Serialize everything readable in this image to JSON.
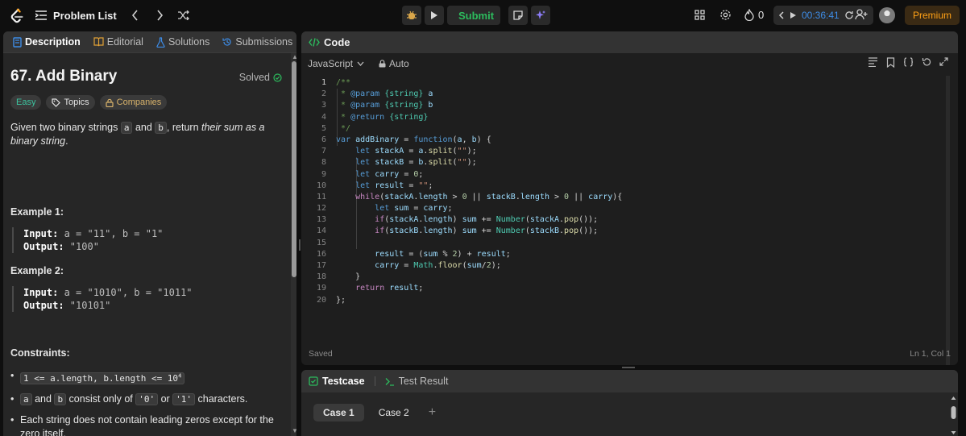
{
  "topbar": {
    "problem_list_label": "Problem List",
    "submit_label": "Submit",
    "streak_count": "0",
    "timer": "00:36:41",
    "premium_label": "Premium"
  },
  "tabs": {
    "description": "Description",
    "editorial": "Editorial",
    "solutions": "Solutions",
    "submissions": "Submissions"
  },
  "problem": {
    "title": "67. Add Binary",
    "status": "Solved",
    "badges": {
      "difficulty": "Easy",
      "topics": "Topics",
      "companies": "Companies"
    },
    "desc_part1": "Given two binary strings ",
    "var_a": "a",
    "desc_and": " and ",
    "var_b": "b",
    "desc_part2": ", return ",
    "desc_em": "their sum as a binary string",
    "desc_end": ".",
    "examples": [
      {
        "heading": "Example 1:",
        "input_label": "Input:",
        "input": " a = \"11\", b = \"1\"",
        "output_label": "Output:",
        "output": " \"100\""
      },
      {
        "heading": "Example 2:",
        "input_label": "Input:",
        "input": " a = \"1010\", b = \"1011\"",
        "output_label": "Output:",
        "output": " \"10101\""
      }
    ],
    "constraints_heading": "Constraints:",
    "c1_code": "1 <= a.length, b.length <= 10",
    "c1_sup": "4",
    "c2_a": "a",
    "c2_and": " and ",
    "c2_b": "b",
    "c2_text": " consist only of ",
    "c2_zero": "'0'",
    "c2_or": " or ",
    "c2_one": "'1'",
    "c2_end": " characters.",
    "c3": "Each string does not contain leading zeros except for the zero itself."
  },
  "editor": {
    "header": "Code",
    "language": "JavaScript",
    "mode": "Auto",
    "status": "Saved",
    "cursor": "Ln 1, Col 1",
    "line_numbers": [
      "1",
      "2",
      "3",
      "4",
      "5",
      "6",
      "7",
      "8",
      "9",
      "10",
      "11",
      "12",
      "13",
      "14",
      "15",
      "16",
      "17",
      "18",
      "19",
      "20"
    ]
  },
  "testpanel": {
    "testcase_tab": "Testcase",
    "result_tab": "Test Result",
    "case1": "Case 1",
    "case2": "Case 2",
    "add": "+"
  }
}
